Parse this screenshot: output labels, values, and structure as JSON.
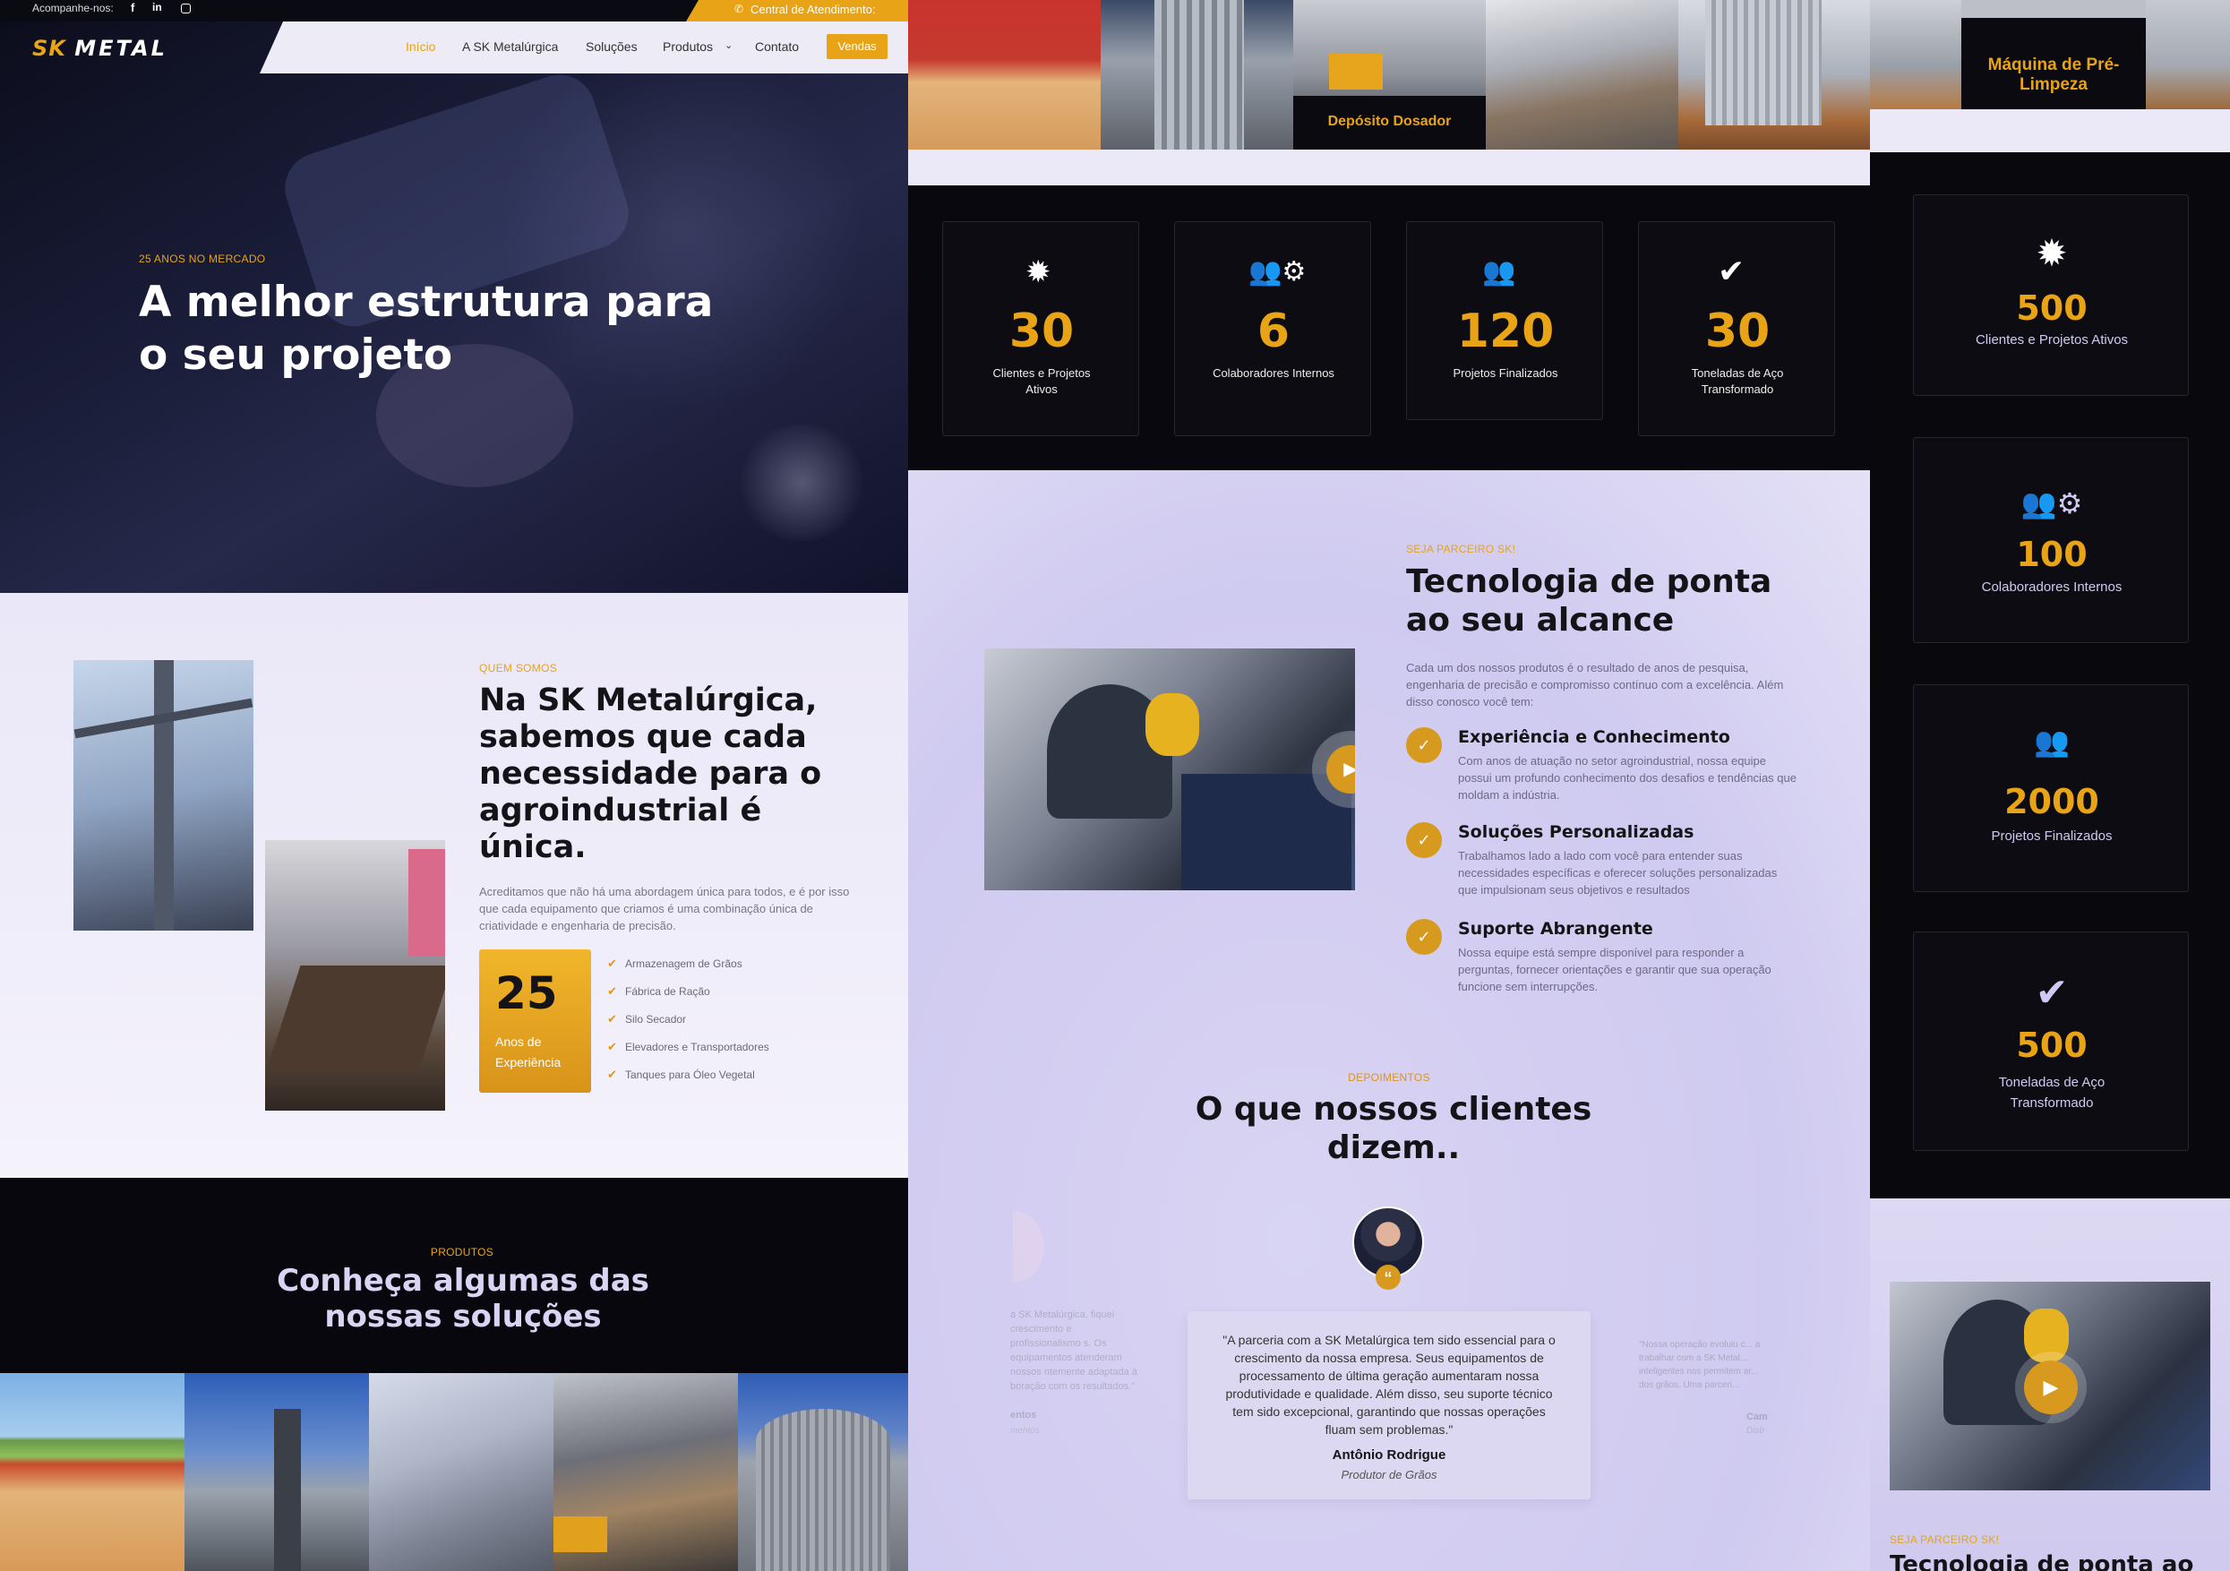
{
  "header": {
    "follow_label": "Acompanhe-nos:",
    "social_icons": [
      "facebook-icon",
      "linkedin-icon",
      "instagram-icon"
    ],
    "support_label": "Central de Atendimento:",
    "logo_sk": "SK",
    "logo_metal": "METAL",
    "nav": [
      "Início",
      "A SK Metalúrgica",
      "Soluções",
      "Produtos",
      "Contato"
    ],
    "nav_cta": "Vendas"
  },
  "hero": {
    "kicker": "25 ANOS NO MERCADO",
    "title": "A melhor estrutura para o seu projeto"
  },
  "about": {
    "kicker": "QUEM SOMOS",
    "title": "Na SK Metalúrgica, sabemos que cada necessidade para o agroindustrial é única.",
    "text": "Acreditamos que não há uma abordagem única para todos, e é por isso que cada equipamento que criamos é uma combinação única de criatividade e engenharia de precisão.",
    "years_number": "25",
    "years_label": "Anos de Experiência",
    "list": [
      "Armazenagem de Grãos",
      "Fábrica de Ração",
      "Silo Secador",
      "Elevadores e Transportadores",
      "Tanques para Óleo Vegetal"
    ]
  },
  "products": {
    "kicker": "PRODUTOS",
    "title": "Conheça algumas das nossas soluções"
  },
  "gallery": {
    "label_doser": "Depósito Dosador",
    "label_cleaner": "Máquina de Pré-Limpeza"
  },
  "stats": [
    {
      "icon": "badge-icon",
      "number": "30",
      "label": "Clientes e Projetos Ativos"
    },
    {
      "icon": "team-gear-icon",
      "number": "6",
      "label": "Colaboradores Internos"
    },
    {
      "icon": "users-icon",
      "number": "120",
      "label": "Projetos Finalizados"
    },
    {
      "icon": "double-check-icon",
      "number": "30",
      "label": "Toneladas de Aço Transformado"
    }
  ],
  "stats_mobile": [
    {
      "number": "500",
      "label": "Clientes e Projetos Ativos"
    },
    {
      "number": "100",
      "label": "Colaboradores Internos"
    },
    {
      "number": "2000",
      "label": "Projetos Finalizados"
    },
    {
      "number": "500",
      "label": "Toneladas de Aço Transformado"
    }
  ],
  "partner": {
    "kicker": "SEJA PARCEIRO SK!",
    "title": "Tecnologia de ponta ao seu alcance",
    "text": "Cada um dos nossos produtos é o resultado de anos de pesquisa, engenharia de precisão e compromisso contínuo com a excelência. Além disso conosco você tem:",
    "features": [
      {
        "title": "Experiência e Conhecimento",
        "text": "Com anos de atuação no setor agroindustrial, nossa equipe possui um profundo conhecimento dos desafios e tendências que moldam a indústria."
      },
      {
        "title": "Soluções Personalizadas",
        "text": "Trabalhamos lado a lado com você para entender suas necessidades específicas e oferecer soluções personalizadas que impulsionam seus objetivos e resultados"
      },
      {
        "title": "Suporte Abrangente",
        "text": "Nossa equipe está sempre disponível para responder a perguntas, fornecer orientações e garantir que sua operação funcione sem interrupções."
      }
    ]
  },
  "testimonials": {
    "kicker": "DEPOIMENTOS",
    "title": "O que nossos clientes dizem..",
    "quote": "\"A parceria com a SK Metalúrgica tem sido essencial para o crescimento da nossa empresa. Seus equipamentos de processamento de última geração aumentaram nossa produtividade e qualidade. Além disso, seu suporte técnico tem sido excepcional, garantindo que nossas operações fluam sem problemas.\"",
    "name": "Antônio Rodrigue",
    "role": "Produtor de Grãos",
    "left_fragment": "a SK Metalúrgica, fiquei crescimento e profissionalismo s. Os equipamentos atenderam nossos ntemente adaptada à boração com os resultados.\"",
    "left_name": "entos",
    "left_role": "mentos",
    "right_fragment": "\"Nossa operação evoluiu c... a trabalhar com a SK Metal... inteligentes nos permitem ar... dos grãos. Uma parceri...",
    "right_name": "Cam",
    "right_role": "Distr"
  },
  "mobile_partner": {
    "kicker": "SEJA PARCEIRO SK!",
    "title": "Tecnologia de ponta ao"
  },
  "colors": {
    "accent": "#e8a317",
    "dark": "#0b0b12",
    "lavender": "#e6e3f6"
  }
}
